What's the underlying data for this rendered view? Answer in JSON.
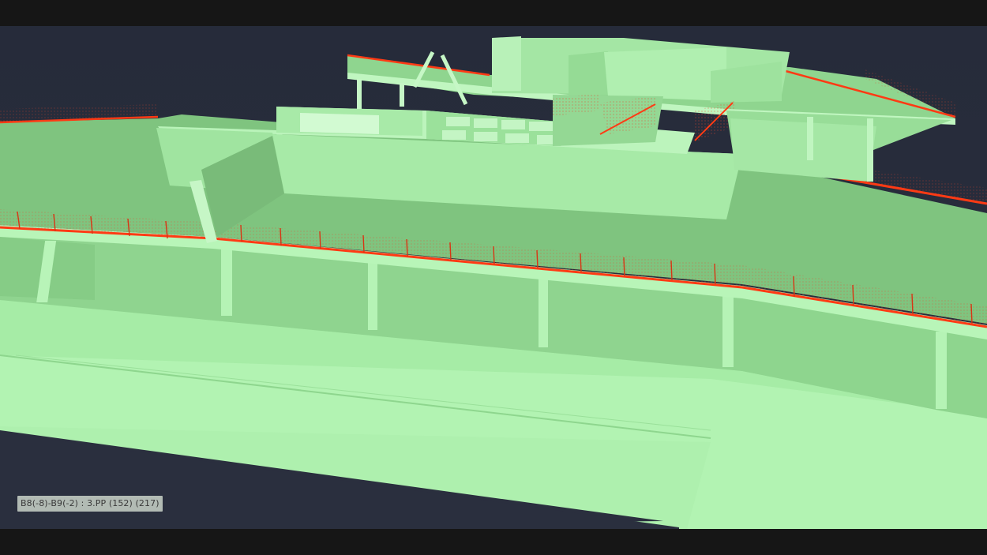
{
  "viewport": {
    "background_color": "#252a38",
    "model_color": "#a9efa9",
    "railing_color": "#ff3a14",
    "selected_element_label": "B8(-8)-B9(-2) : 3.PP (152) (217)"
  }
}
